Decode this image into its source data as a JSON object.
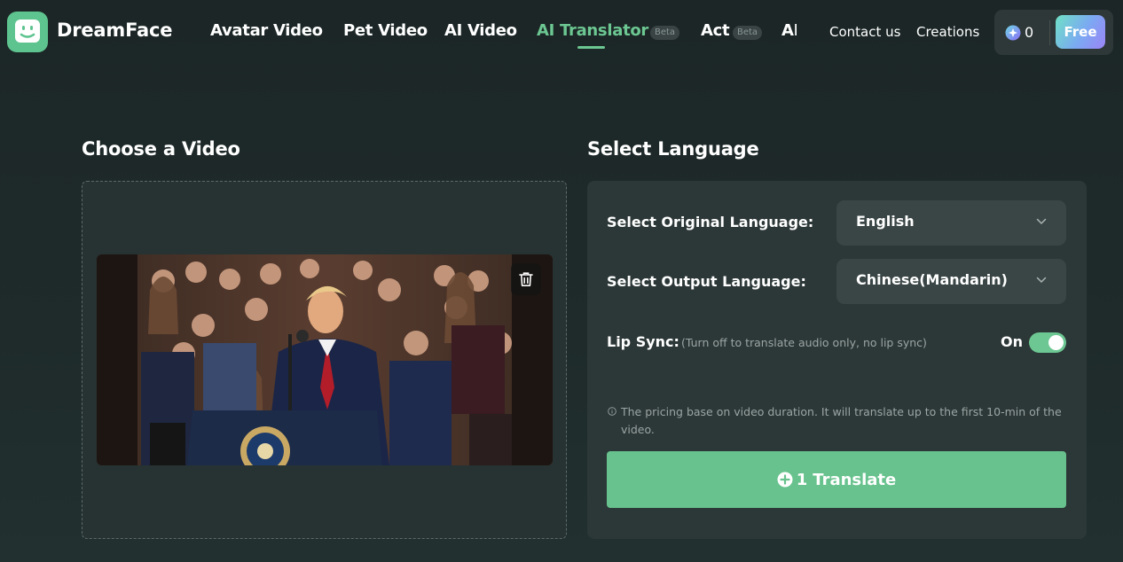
{
  "header": {
    "brand": "DreamFace",
    "nav": [
      {
        "label": "Avatar Video"
      },
      {
        "label": "Pet Video"
      },
      {
        "label": "AI Video"
      },
      {
        "label": "AI Translator",
        "badge": "Beta",
        "active": true
      },
      {
        "label": "Act",
        "badge": "Beta"
      },
      {
        "label": "AI"
      }
    ],
    "links": {
      "contact": "Contact us",
      "creations": "Creations"
    },
    "credits": "0",
    "free_label": "Free"
  },
  "left": {
    "title": "Choose a Video"
  },
  "right": {
    "title": "Select Language",
    "original_label": "Select Original Language:",
    "original_value": "English",
    "output_label": "Select Output Language:",
    "output_value": "Chinese(Mandarin)",
    "lip_label": "Lip Sync:",
    "lip_hint": "(Turn off to translate audio only, no lip sync)",
    "lip_state": "On",
    "info": "The pricing base on video duration. It will translate up to the first 10-min of the video.",
    "translate_cost": "1",
    "translate_label": "Translate"
  },
  "colors": {
    "accent": "#6cc792",
    "button": "#67c28d",
    "background": "#1f2b2b",
    "panel": "#2c3737"
  },
  "icons": [
    "dreamface-logo-icon",
    "coin-icon",
    "trash-icon",
    "chevron-down-icon",
    "info-icon",
    "plus-circle-icon"
  ]
}
